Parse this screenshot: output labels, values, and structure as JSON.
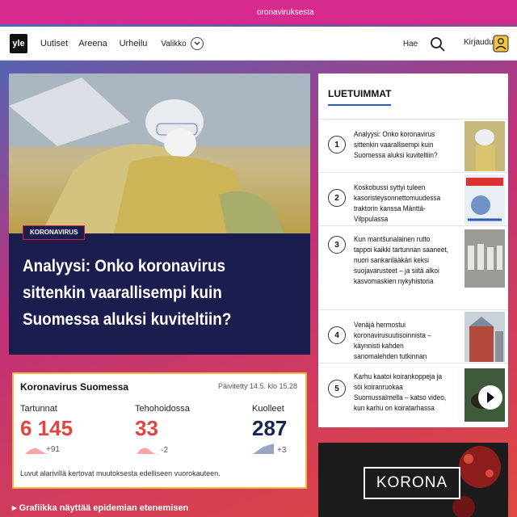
{
  "banner": {
    "link_text": "oronaviruksesta"
  },
  "nav": {
    "logo": "yle",
    "items": [
      "Uutiset",
      "Areena",
      "Urheilu"
    ],
    "menu_label": "Valikko",
    "search_label": "Hae",
    "login_label": "Kirjaudu"
  },
  "hero": {
    "tag": "KORONAVIRUS",
    "title": "Analyysi: Onko koronavirus sittenkin vaarallisempi kuin Suomessa aluksi kuviteltiin?"
  },
  "sidebar": {
    "heading": "LUETUIMMAT",
    "items": [
      {
        "num": "1",
        "text": "Analyysi: Onko koronavirus sittenkin vaarallisempi kuin Suomessa aluksi kuviteltiin?"
      },
      {
        "num": "2",
        "text": "Koskobussi syttyi tuleen kasoristeysonnettomuudessa traktorin kanssa Mänttä-Vilppulassa"
      },
      {
        "num": "3",
        "text": "Kun mantšurialainen rutto tappoi kaikki tartunnan saaneet, nuori sankarilääkäri keksi suojavarusteet – ja siitä alkoi kasvomaskien nykyhistoria"
      },
      {
        "num": "4",
        "text": "Venäjä hermostui koronavirusuutisoinnista – käynnisti kahden sanomalehden tutkinnan"
      },
      {
        "num": "5",
        "text": "Karhu kaatoi koirankoppeja ja söi koiranruokaa Suomussalmella – katso video, kun karhu on koiratarhassa"
      }
    ]
  },
  "stats": {
    "title": "Koronavirus Suomessa",
    "updated": "Päivitetty 14.5. klo 15.28",
    "cols": [
      {
        "label": "Tartunnat",
        "value": "6 145",
        "delta": "+91",
        "color": "#e0463f"
      },
      {
        "label": "Tehohoidossa",
        "value": "33",
        "delta": "-2",
        "color": "#e0463f"
      },
      {
        "label": "Kuolleet",
        "value": "287",
        "delta": "+3",
        "color": "#14254f"
      }
    ],
    "note": "Luvut alarivillä kertovat muutoksesta edelliseen vuorokauteen."
  },
  "graph_link": "Grafiikka näyttää epidemian etenemisen",
  "promo": {
    "title": "KORONA"
  },
  "colors": {
    "brand": "#d72a8e",
    "hero_bg": "#1b1d4f",
    "accent": "#2a5cb8"
  }
}
